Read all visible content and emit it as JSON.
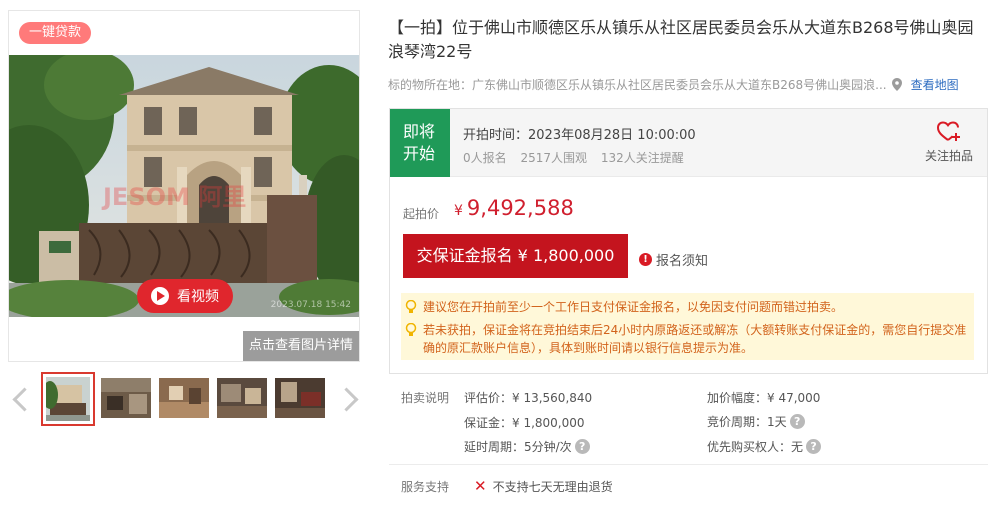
{
  "gallery": {
    "loan_badge": "一键贷款",
    "video_label": "看视频",
    "watermark_text": "JESOM 阿里",
    "photo_timestamp": "2023.07.18 15:42",
    "detail_button": "点击查看图片详情",
    "thumbnail_count": 5
  },
  "listing": {
    "title": "【一拍】位于佛山市顺德区乐从镇乐从社区居民委员会乐从大道东B268号佛山奥园浪琴湾22号",
    "location_label": "标的物所在地：",
    "location_value": "广东佛山市顺德区乐从镇乐从社区居民委员会乐从大道东B268号佛山奥园浪...",
    "map_link": "查看地图"
  },
  "auction": {
    "status": "即将开始",
    "start_time": "开拍时间：2023年08月28日 10:00:00",
    "signups": "0人报名",
    "views": "2517人围观",
    "reminders": "132人关注提醒",
    "follow_label": "关注拍品",
    "start_price_label": "起拍价",
    "currency": "¥",
    "start_price": "9,492,588",
    "deposit_button": "交保证金报名 ¥ 1,800,000",
    "notice_label": "报名须知",
    "tips": [
      "建议您在开拍前至少一个工作日支付保证金报名，以免因支付问题而错过拍卖。",
      "若未获拍，保证金将在竞拍结束后24小时内原路返还或解冻（大额转账支付保证金的，需您自行提交准确的原汇款账户信息），具体到账时间请以银行信息提示为准。"
    ]
  },
  "properties": {
    "section_label": "拍卖说明",
    "appraisal": "评估价：¥ 13,560,840",
    "increment": "加价幅度：¥ 47,000",
    "deposit": "保证金：¥ 1,800,000",
    "cycle": "竞价周期：1天",
    "delay": "延时周期：5分钟/次",
    "priority": "优先购买权人：无"
  },
  "service": {
    "section_label": "服务支持",
    "no_return": "不支持七天无理由退货"
  },
  "colors": {
    "accent_red": "#c4141e",
    "status_green": "#1f9a58",
    "link_blue": "#2d6cc0",
    "tip_orange": "#d2631c"
  }
}
